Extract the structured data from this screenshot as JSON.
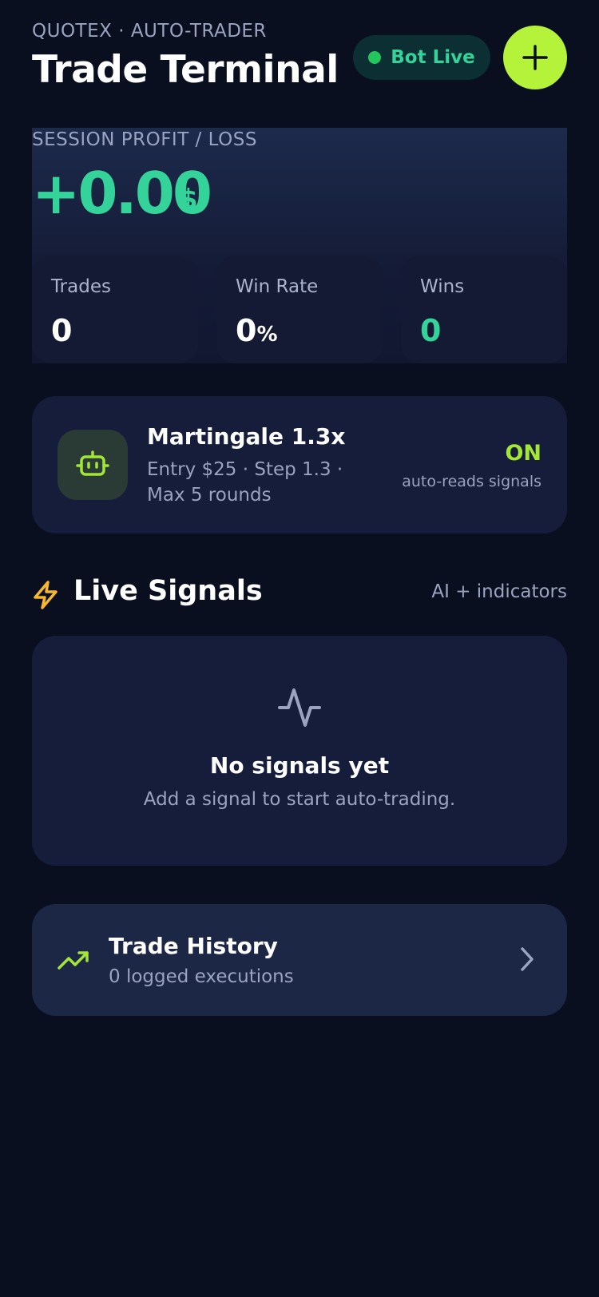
{
  "header": {
    "eyebrow": "QUOTEX · AUTO-TRADER",
    "title": "Trade Terminal",
    "bot_status": "Bot Live",
    "add_icon": "plus-icon"
  },
  "session": {
    "label": "SESSION PROFIT / LOSS",
    "value": "+0.00",
    "currency": "$",
    "stats": [
      {
        "label": "Trades",
        "value": "0",
        "unit": ""
      },
      {
        "label": "Win Rate",
        "value": "0",
        "unit": "%"
      },
      {
        "label": "Wins",
        "value": "0",
        "unit": ""
      }
    ]
  },
  "strategy": {
    "icon": "robot-icon",
    "name": "Martingale 1.3x",
    "description": "Entry $25 · Step 1.3 · Max 5 rounds",
    "state": "ON",
    "state_sub": "auto-reads signals"
  },
  "signals": {
    "icon": "lightning-icon",
    "title": "Live Signals",
    "meta": "AI + indicators",
    "empty_icon": "activity-icon",
    "empty_title": "No signals yet",
    "empty_subtitle": "Add a signal to start auto-trading."
  },
  "history": {
    "icon": "trending-up-icon",
    "title": "Trade History",
    "subtitle": "0 logged executions",
    "chevron": "chevron-right-icon"
  },
  "colors": {
    "background": "#0a0f20",
    "accent_lime": "#b5f23a",
    "profit_green": "#34d399",
    "card": "#161d3a",
    "muted_text": "#9aa3c0"
  }
}
